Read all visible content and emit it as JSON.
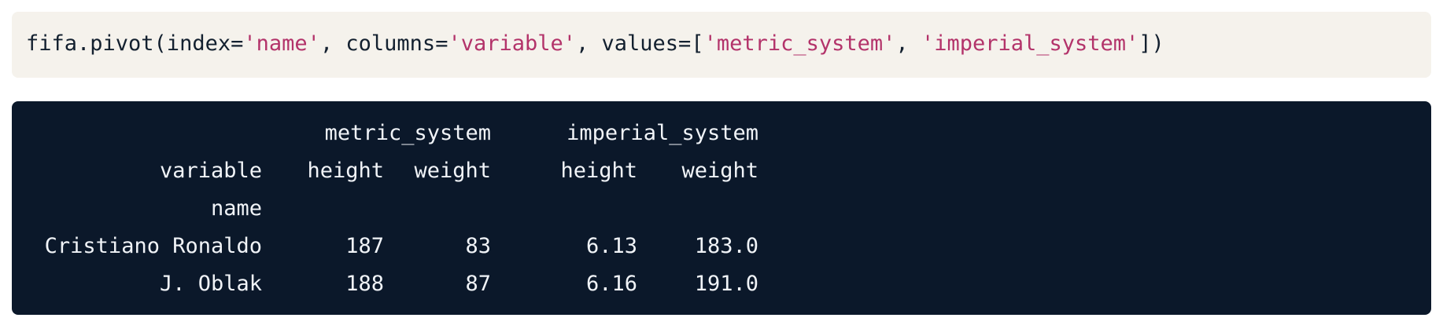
{
  "code": {
    "tokens": [
      {
        "text": "fifa.pivot(index=",
        "kind": "plain"
      },
      {
        "text": "'name'",
        "kind": "str"
      },
      {
        "text": ", columns=",
        "kind": "plain"
      },
      {
        "text": "'variable'",
        "kind": "str"
      },
      {
        "text": ", values=[",
        "kind": "plain"
      },
      {
        "text": "'metric_system'",
        "kind": "str"
      },
      {
        "text": ", ",
        "kind": "plain"
      },
      {
        "text": "'imperial_system'",
        "kind": "str"
      },
      {
        "text": "])",
        "kind": "plain"
      }
    ]
  },
  "output": {
    "top_headers": [
      "metric_system",
      "imperial_system"
    ],
    "index_header": "variable",
    "sub_headers": [
      "height",
      "weight",
      "height",
      "weight"
    ],
    "index_name": "name",
    "rows": [
      {
        "name": "Cristiano Ronaldo",
        "values": [
          "187",
          "83",
          "6.13",
          "183.0"
        ]
      },
      {
        "name": "J. Oblak",
        "values": [
          "188",
          "87",
          "6.16",
          "191.0"
        ]
      }
    ]
  },
  "colors": {
    "code_background": "#f5f2ec",
    "code_text": "#13202f",
    "string_token": "#b3336a",
    "output_background": "#0b182a",
    "output_text": "#f1f4f8"
  }
}
